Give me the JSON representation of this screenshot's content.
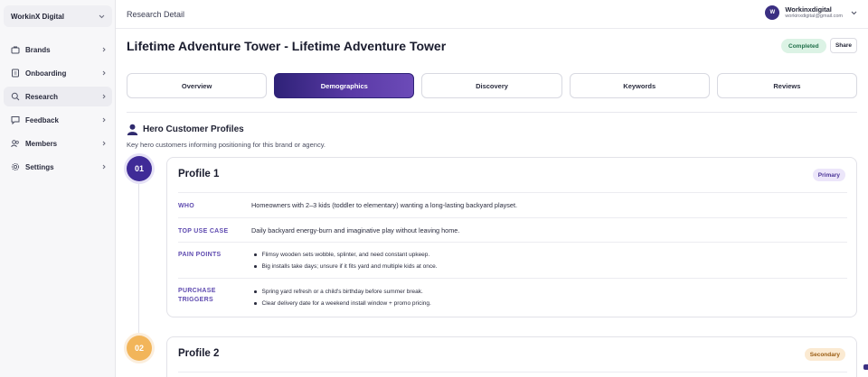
{
  "sidebar": {
    "workspace": "WorkinX Digital",
    "items": [
      {
        "label": "Brands",
        "icon": "briefcase-icon"
      },
      {
        "label": "Onboarding",
        "icon": "document-icon"
      },
      {
        "label": "Research",
        "icon": "search-icon",
        "active": true
      },
      {
        "label": "Feedback",
        "icon": "chat-icon"
      },
      {
        "label": "Members",
        "icon": "users-icon"
      },
      {
        "label": "Settings",
        "icon": "gear-icon"
      }
    ]
  },
  "topbar": {
    "breadcrumb": "Research Detail",
    "user": {
      "initial": "W",
      "name": "Workinxdigital",
      "email": "workinxdigital@gmail.com"
    }
  },
  "header": {
    "title": "Lifetime Adventure Tower - Lifetime Adventure Tower",
    "status": "Completed",
    "share_label": "Share"
  },
  "tabs": [
    "Overview",
    "Demographics",
    "Discovery",
    "Keywords",
    "Reviews"
  ],
  "active_tab": "Demographics",
  "section": {
    "title": "Hero Customer Profiles",
    "description": "Key hero customers informing positioning for this brand or agency."
  },
  "profiles": [
    {
      "number": "01",
      "title": "Profile 1",
      "badge": "Primary",
      "who_label": "WHO",
      "who": "Homeowners with 2–3 kids (toddler to elementary) wanting a long-lasting backyard playset.",
      "use_case_label": "TOP USE CASE",
      "use_case": "Daily backyard energy-burn and imaginative play without leaving home.",
      "pain_label": "PAIN POINTS",
      "pain_points": [
        "Flimsy wooden sets wobble, splinter, and need constant upkeep.",
        "Big installs take days; unsure if it fits yard and multiple kids at once."
      ],
      "triggers_label_1": "PURCHASE",
      "triggers_label_2": "TRIGGERS",
      "triggers": [
        "Spring yard refresh or a child's birthday before summer break.",
        "Clear delivery date for a weekend install window + promo pricing."
      ]
    },
    {
      "number": "02",
      "title": "Profile 2",
      "badge": "Secondary"
    }
  ],
  "colors": {
    "brand": "#3b2f82",
    "accent_label": "#5f4bb0",
    "status_bg": "#dcf3e5",
    "status_text": "#21704a",
    "secondary_num": "#f2b55a"
  }
}
